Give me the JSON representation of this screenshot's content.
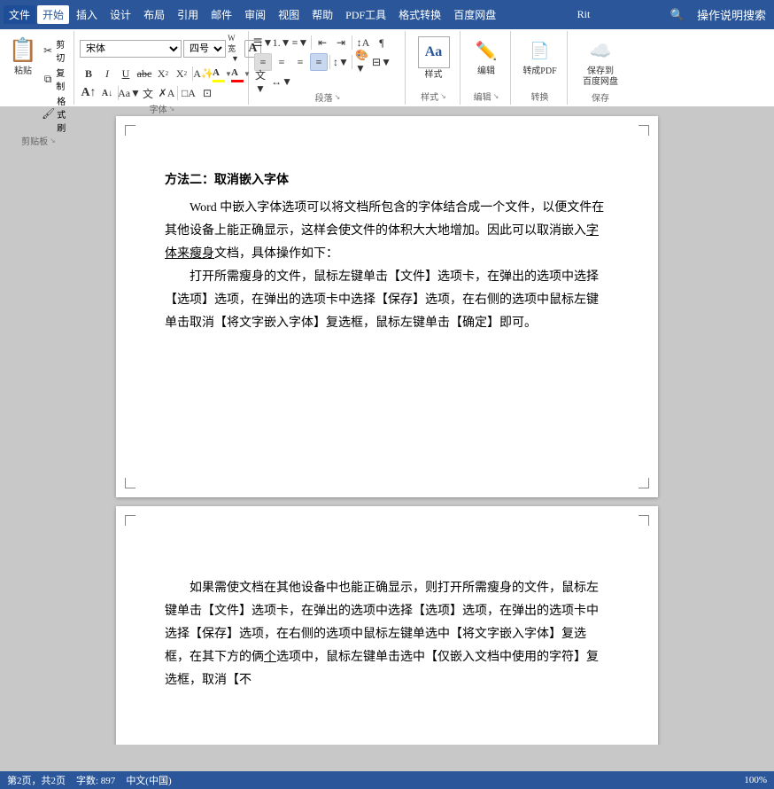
{
  "topbar": {
    "buttons": [
      "文件",
      "开始",
      "插入",
      "设计",
      "布局",
      "引用",
      "邮件",
      "审阅",
      "视图",
      "帮助",
      "PDF工具",
      "格式转换",
      "百度网盘"
    ],
    "active_tab": "开始",
    "title": "Rit",
    "right_icons": [
      "🔍",
      "操作说明搜索"
    ]
  },
  "ribbon": {
    "clipboard_label": "剪贴板",
    "font_label": "字体",
    "paragraph_label": "段落",
    "style_label": "样式",
    "edit_label": "编辑",
    "convert_label": "转换",
    "save_label": "保存",
    "font_name": "宋体",
    "font_size": "四号",
    "style_btn": "样式",
    "edit_btn": "编辑",
    "convert_btn": "转成PDF",
    "save_btn": "保存到\n百度网盘",
    "paste_label": "粘贴",
    "cut_label": "剪切",
    "copy_label": "复制",
    "format_painter_label": "格式刷"
  },
  "page1": {
    "heading": "方法二：取消嵌入字体",
    "para1": "Word 中嵌入字体选项可以将文档所包含的字体结合成一个文件，以便文件在其他设备上能正确显示，这样会使文件的体积大大地增加。因此可以取消嵌入字体来瘦身文档，具体操作如下：",
    "para2": "打开所需瘦身的文件，鼠标左键单击【文件】选项卡，在弹出的选项中选择【选项】选项，在弹出的选项卡中选择【保存】选项，在右侧的选项中鼠标左键单击取消【将文字嵌入字体】复选框，鼠标左键单击【确定】即可。",
    "underline_text": "字体来瘦身"
  },
  "page2": {
    "para1": "如果需使文档在其他设备中也能正确显示，则打开所需瘦身的文件，鼠标左键单击【文件】选项卡，在弹出的选项中选择【选项】选项，在弹出的选项卡中选择【保存】选项，在右侧的选项中鼠标左键单选中【将文字嵌入字体】复选框，在其下方的俩个选项中，鼠标左键单击选中【仅嵌入文档中使用的字符】复选框，取消【不"
  },
  "statusbar": {
    "pages": "第2页，共2页",
    "words": "字数: 897",
    "lang": "中文(中国)",
    "zoom": "100%"
  }
}
